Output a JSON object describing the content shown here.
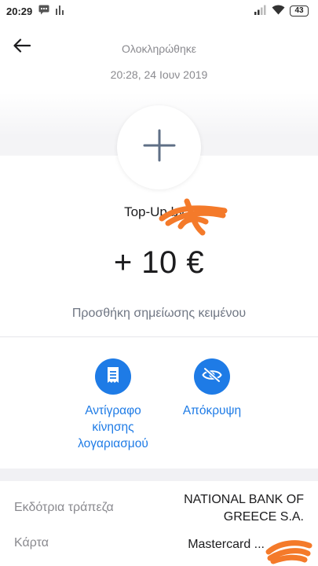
{
  "status_bar": {
    "time": "20:29",
    "battery": "43"
  },
  "header": {
    "status": "Ολοκληρώθηκε",
    "datetime": "20:28, 24 Ιουν 2019"
  },
  "transaction": {
    "title": "Top-Up by *",
    "amount": "+ 10 €",
    "add_note": "Προσθήκη σημείωσης κειμένου"
  },
  "actions": [
    {
      "label": "Αντίγραφο κίνησης λογαριασμού",
      "icon": "receipt-icon"
    },
    {
      "label": "Απόκρυψη",
      "icon": "eye-off-icon"
    }
  ],
  "details": [
    {
      "label": "Εκδότρια τράπεζα",
      "value": "NATIONAL BANK OF GREECE S.A."
    },
    {
      "label": "Κάρτα",
      "value": "Mastercard ..."
    }
  ],
  "colors": {
    "accent": "#1e7be6",
    "redaction": "#f47a2a",
    "muted_text": "#8a8a8f"
  }
}
